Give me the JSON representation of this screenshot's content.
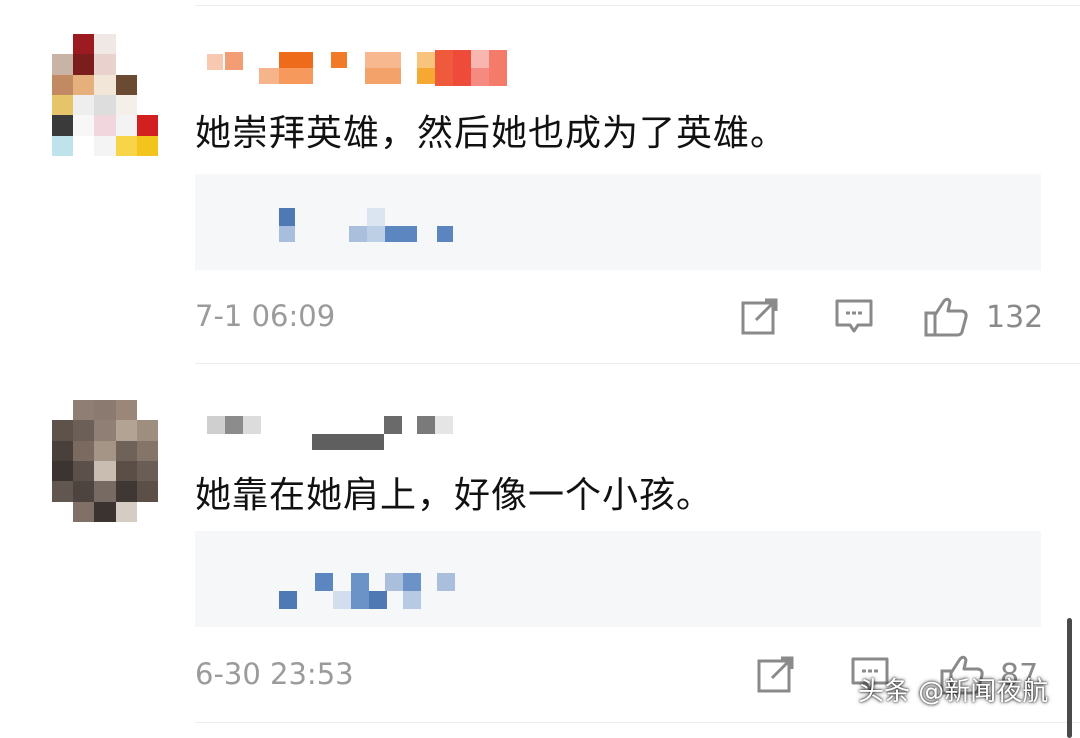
{
  "comments": [
    {
      "text": "她崇拜英雄，然后她也成为了英雄。",
      "time": "7-1 06:09",
      "likes": "132",
      "icons": {
        "share": "share-icon",
        "reply": "comment-icon",
        "like": "thumbs-up-icon"
      }
    },
    {
      "text": "她靠在她肩上，好像一个小孩。",
      "time": "6-30 23:53",
      "likes": "87",
      "icons": {
        "share": "share-icon",
        "reply": "comment-icon",
        "like": "thumbs-up-icon"
      }
    }
  ],
  "watermark": "头条 @新闻夜航",
  "colors": {
    "text": "#111111",
    "meta": "#9b9b9b",
    "quote_bg": "#f6f7f9",
    "pixel_blue": "#5b86c0"
  }
}
